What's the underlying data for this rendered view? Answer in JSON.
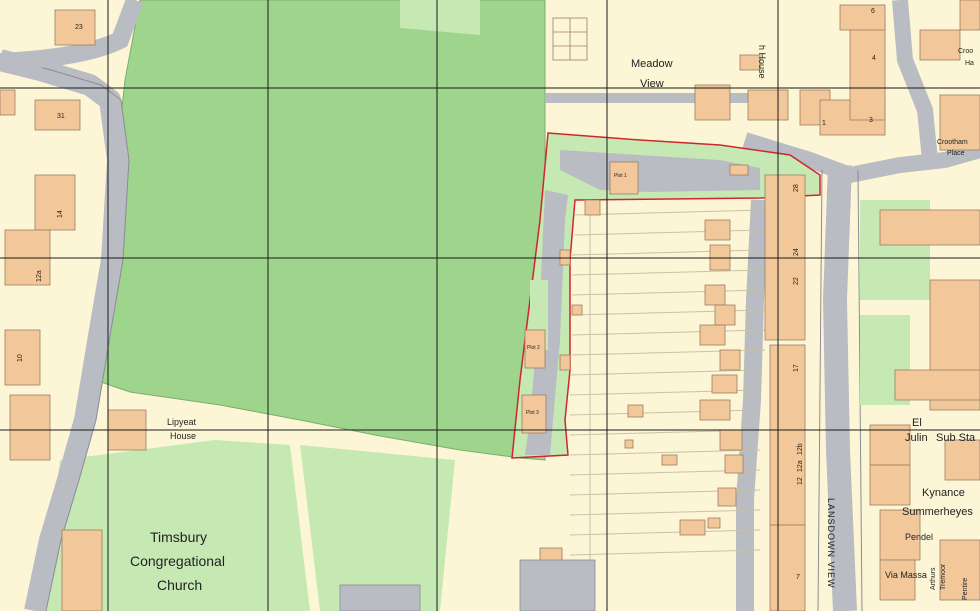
{
  "map": {
    "colors": {
      "background": "#fdf6d6",
      "park": "#9fd48d",
      "park_light": "#c6e9b4",
      "road": "#b9bcc2",
      "building": "#f2c89a",
      "building_edge": "#9a7f63",
      "grid": "#1a1a1a",
      "site_boundary": "#d0262e",
      "parcel_line": "#c8c2a8"
    },
    "labels": {
      "house_23": "23",
      "house_31": "31",
      "house_14": "14",
      "house_12a": "12a",
      "house_10": "10",
      "meadow_1": "Meadow",
      "meadow_2": "View",
      "vert_house": "h House",
      "num_6": "6",
      "num_4": "4",
      "num_1": "1",
      "num_3": "3",
      "croo_1": "Croo",
      "croo_2": "Ha",
      "crothen_1": "Crootham",
      "crothen_2": "Place",
      "plot_1": "Plot 1",
      "plot_2": "Plot 2",
      "plot_3": "Plot 3",
      "num_28": "28",
      "num_24": "24",
      "num_22": "22",
      "num_17": "17",
      "num_12b": "12b",
      "num_12a": "12a",
      "num_12": "12",
      "num_7": "7",
      "lipyeat_1": "Lipyeat",
      "lipyeat_2": "House",
      "chapel_1": "Timsbury",
      "chapel_2": "Congregational",
      "chapel_3": "Church",
      "road": "LANSDOWN VIEW",
      "el": "El",
      "julin": "Julin",
      "substa": "Sub Sta",
      "kynance": "Kynance",
      "summerheyes": "Summerheyes",
      "pendel": "Pendel",
      "via_massa": "Via Massa",
      "arthurs_1": "Arthurs",
      "arthurs_2": "Tremoor",
      "pentire": "Pentire"
    }
  }
}
